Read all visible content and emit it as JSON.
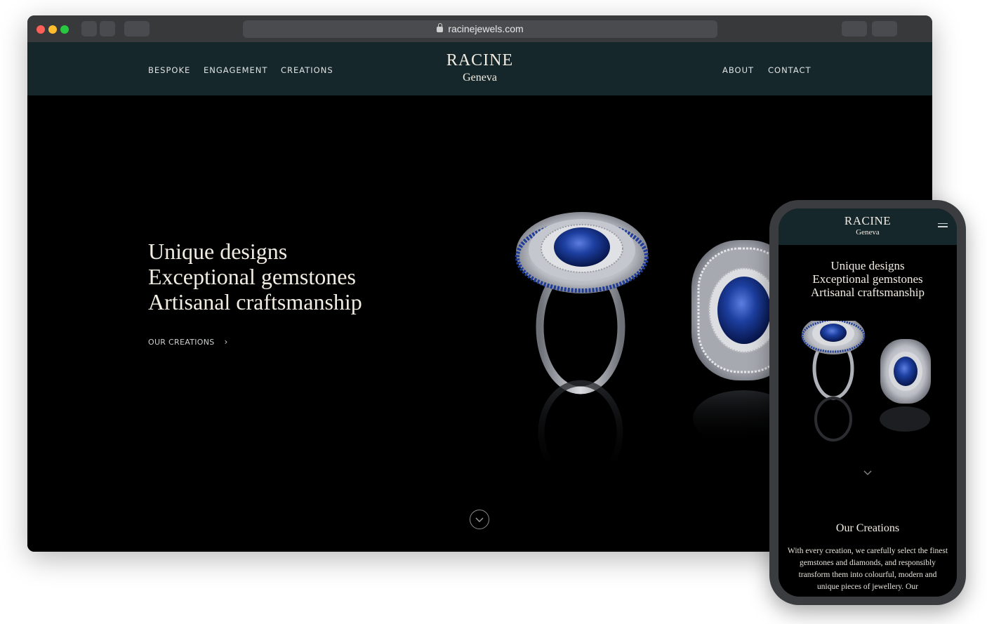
{
  "browser": {
    "url": "racinejewels.com"
  },
  "site": {
    "brand": "RACINE",
    "city": "Geneva",
    "nav_left": [
      "BESPOKE",
      "ENGAGEMENT",
      "CREATIONS"
    ],
    "nav_right": [
      "ABOUT",
      "CONTACT"
    ],
    "hero_lines": [
      "Unique designs",
      "Exceptional gemstones",
      "Artisanal craftsmanship"
    ],
    "cta_label": "OUR CREATIONS",
    "cta_chevron": "›"
  },
  "colors": {
    "header_bg": "#16272b",
    "hero_bg": "#000000",
    "sapphire": "#1d3fa0",
    "diamond": "#c9ccd2"
  },
  "mobile": {
    "brand": "RACINE",
    "city": "Geneva",
    "hero_lines": [
      "Unique designs",
      "Exceptional gemstones",
      "Artisanal craftsmanship"
    ],
    "section_title": "Our Creations",
    "section_text": "With every creation, we carefully select the finest gemstones and diamonds, and responsibly transform them into colourful, modern and unique pieces of jewellery. Our"
  },
  "icons": {
    "lock": "lock-icon",
    "scroll": "chevron-down-circle-icon",
    "menu": "hamburger-menu-icon"
  }
}
